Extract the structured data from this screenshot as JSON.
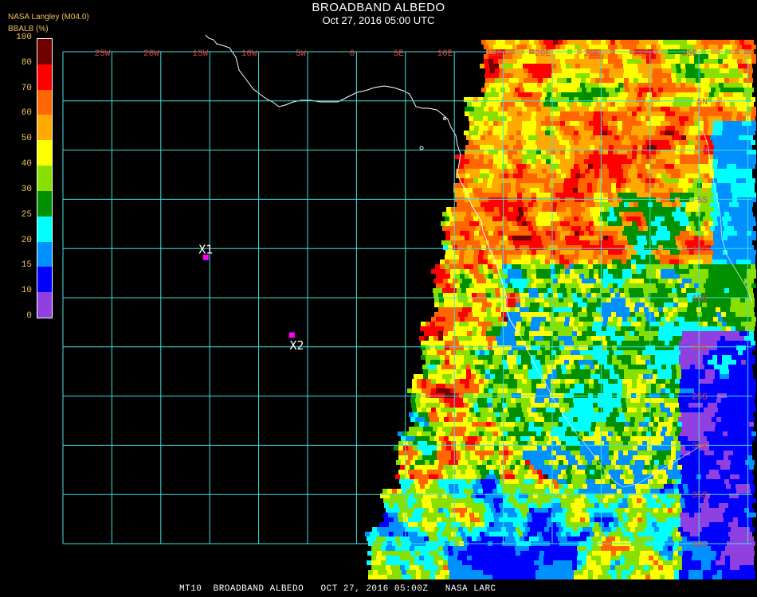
{
  "header": {
    "title": "BROADBAND ALBEDO",
    "datetime": "Oct 27, 2016 05:00 UTC",
    "provider": "NASA Langley (M04.0)"
  },
  "colorbar": {
    "label": "BBALB (%)",
    "ticks": [
      "100",
      "80",
      "70",
      "60",
      "50",
      "40",
      "30",
      "25",
      "20",
      "15",
      "10",
      "0"
    ],
    "tick_values": [
      100,
      80,
      70,
      60,
      50,
      40,
      30,
      25,
      20,
      15,
      10,
      0
    ],
    "segments": [
      {
        "from": 80,
        "to": 100,
        "color": "#6e0000"
      },
      {
        "from": 70,
        "to": 80,
        "color": "#ff0000"
      },
      {
        "from": 60,
        "to": 70,
        "color": "#ff6600"
      },
      {
        "from": 50,
        "to": 60,
        "color": "#ffaa00"
      },
      {
        "from": 40,
        "to": 50,
        "color": "#ffff00"
      },
      {
        "from": 30,
        "to": 40,
        "color": "#88e000"
      },
      {
        "from": 25,
        "to": 30,
        "color": "#009000"
      },
      {
        "from": 20,
        "to": 25,
        "color": "#00ffff"
      },
      {
        "from": 15,
        "to": 20,
        "color": "#0090ff"
      },
      {
        "from": 10,
        "to": 15,
        "color": "#0000ff"
      },
      {
        "from": 0,
        "to": 10,
        "color": "#9040e0"
      }
    ]
  },
  "map": {
    "lon_labels": [
      "25W",
      "20W",
      "15W",
      "10W",
      "5W",
      "0",
      "5E",
      "10E",
      "15E",
      "20E",
      "25E",
      "30E",
      "35E"
    ],
    "lat_labels": [
      "5N",
      "0",
      "5S",
      "10S",
      "15S",
      "20S",
      "25S",
      "30S",
      "35S",
      "40S"
    ],
    "grid_color": "#40e0e0",
    "label_color": "#e04040",
    "markers": [
      {
        "label": "X1",
        "lon": -15.4,
        "lat": -10.9,
        "color": "#ff00ff"
      },
      {
        "label": "X2",
        "lon": -6.6,
        "lat": -18.8,
        "color": "#ff00ff"
      }
    ]
  },
  "footer": {
    "text": "MT10  BROADBAND ALBEDO   OCT 27, 2016 05:00Z   NASA LARC"
  }
}
